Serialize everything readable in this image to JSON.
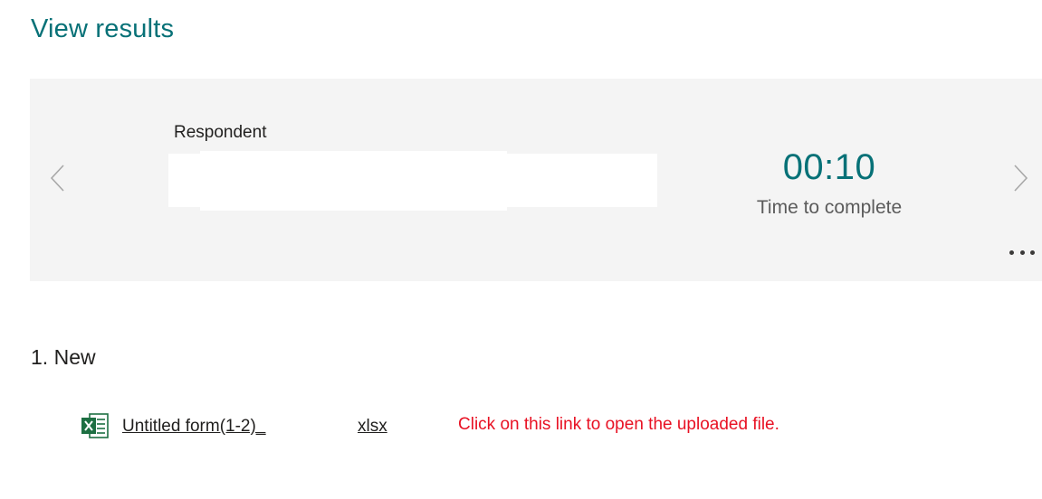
{
  "page": {
    "title": "View results"
  },
  "summary": {
    "respondent_label": "Respondent",
    "respondent_value": "",
    "time_value": "00:10",
    "time_label": "Time to complete",
    "prev_icon": "chevron-left-icon",
    "next_icon": "chevron-right-icon",
    "more_icon": "more-horizontal-icon"
  },
  "question": {
    "number": "1.",
    "title": "New",
    "file": {
      "icon": "excel-file-icon",
      "name": "Untitled form(1-2)_",
      "extension": "xlsx"
    },
    "hint": "Click on this link to open the uploaded file."
  },
  "colors": {
    "accent": "#077177",
    "card_background": "#f4f4f4",
    "hint": "#e81123",
    "excel_green": "#1d6f42"
  }
}
